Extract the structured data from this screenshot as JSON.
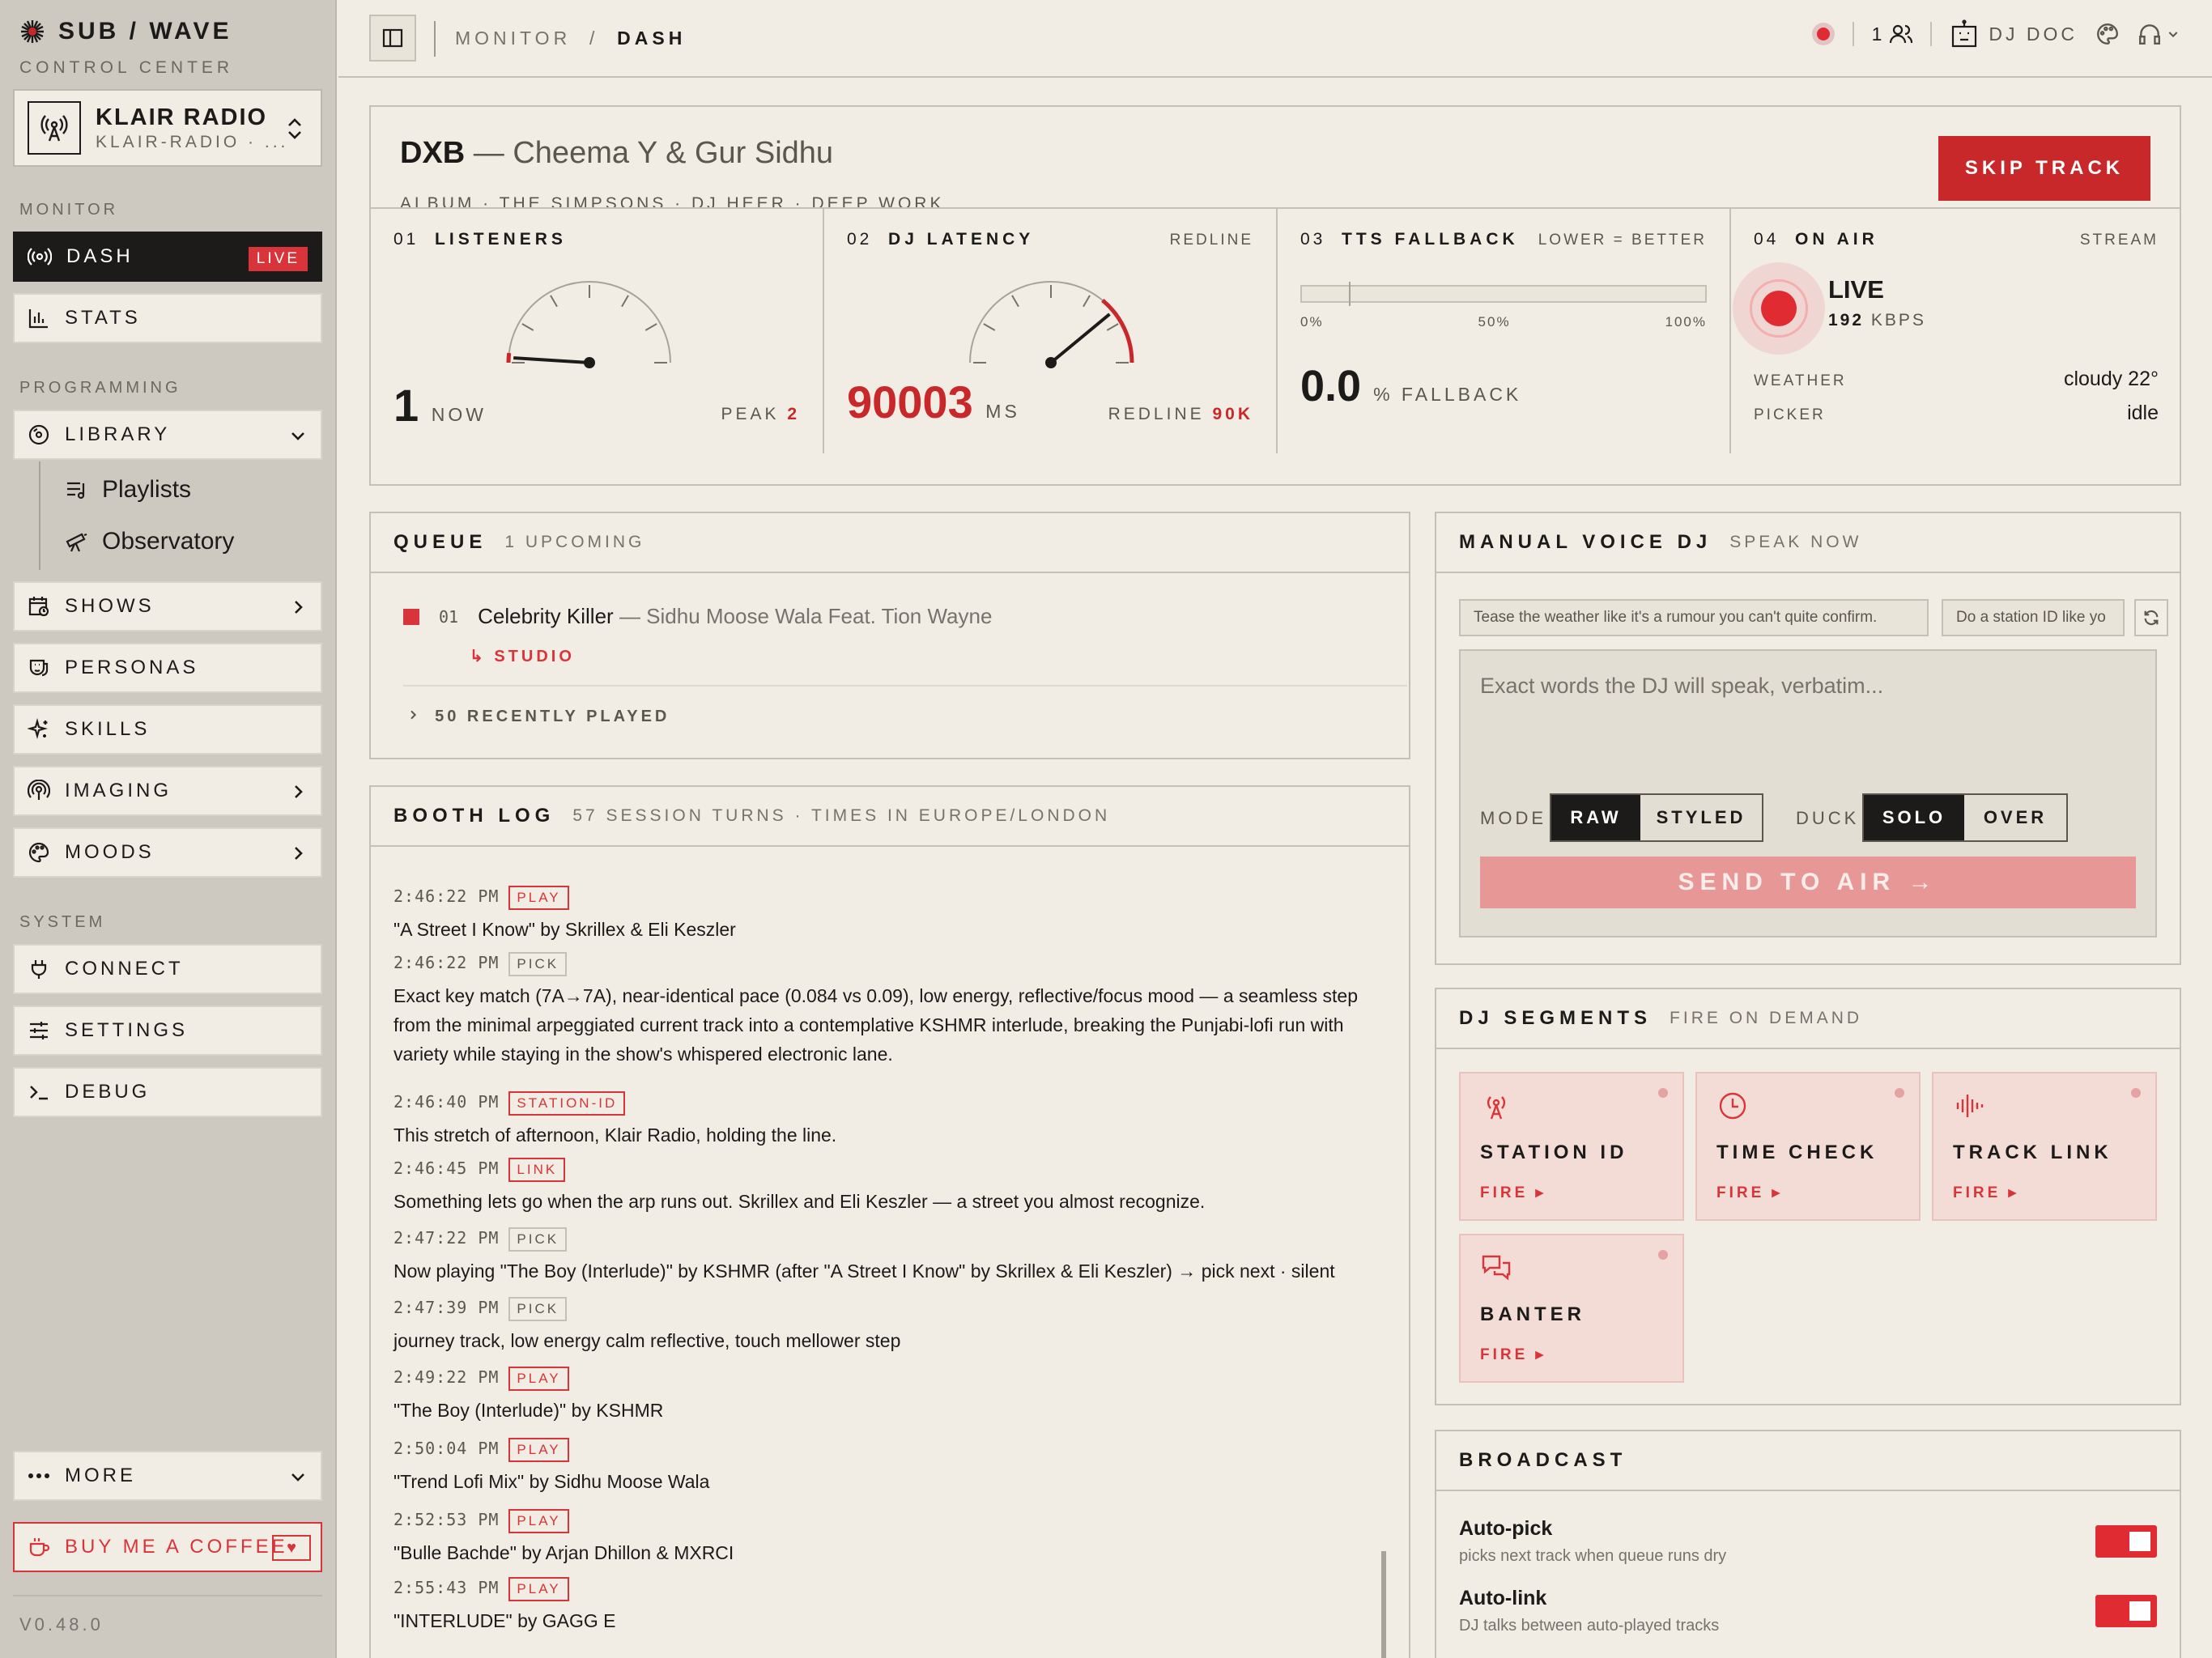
{
  "brand": {
    "title": "SUB / WAVE",
    "subtitle": "CONTROL CENTER"
  },
  "station": {
    "name": "KLAIR RADIO",
    "slug": "KLAIR-RADIO · ..."
  },
  "sidebar": {
    "sections": {
      "monitor": "MONITOR",
      "programming": "PROGRAMMING",
      "system": "SYSTEM"
    },
    "dash": "DASH",
    "live_badge": "LIVE",
    "stats": "STATS",
    "library": "LIBRARY",
    "playlists": "Playlists",
    "observatory": "Observatory",
    "shows": "SHOWS",
    "personas": "PERSONAS",
    "skills": "SKILLS",
    "imaging": "IMAGING",
    "moods": "MOODS",
    "connect": "CONNECT",
    "settings": "SETTINGS",
    "debug": "DEBUG",
    "more": "MORE",
    "coffee": "BUY ME A COFFEE",
    "version": "V0.48.0"
  },
  "topbar": {
    "crumb_root": "MONITOR",
    "crumb_sep": "/",
    "crumb_page": "DASH",
    "listeners": "1",
    "dj": "DJ DOC"
  },
  "now_playing": {
    "title": "DXB",
    "artists": "— Cheema Y & Gur Sidhu",
    "meta": "ALBUM · THE SIMPSONS · DJ HEER · DEEP WORK",
    "skip_label": "SKIP TRACK"
  },
  "stats": {
    "listeners": {
      "num": "01",
      "label": "LISTENERS",
      "value": "1",
      "unit": "NOW",
      "peak_label": "PEAK",
      "peak": "2",
      "gauge_fraction": 0.02
    },
    "latency": {
      "num": "02",
      "label": "DJ LATENCY",
      "right": "REDLINE",
      "value": "90003",
      "unit": "MS",
      "redline_label": "REDLINE",
      "redline": "90K",
      "gauge_fraction": 0.78
    },
    "tts": {
      "num": "03",
      "label": "TTS FALLBACK",
      "right": "LOWER = BETTER",
      "ticks": [
        "0%",
        "50%",
        "100%"
      ],
      "value": "0.0",
      "unit": "% FALLBACK"
    },
    "onair": {
      "num": "04",
      "label": "ON AIR",
      "right": "STREAM",
      "status": "LIVE",
      "bitrate": "192",
      "bitrate_unit": "KBPS",
      "weather_label": "WEATHER",
      "weather": "cloudy 22°",
      "picker_label": "PICKER",
      "picker": "idle"
    }
  },
  "queue": {
    "title": "QUEUE",
    "subtitle": "1 UPCOMING",
    "item": {
      "index": "01",
      "track": "Celebrity Killer",
      "artist": "— Sidhu Moose Wala Feat. Tion Wayne",
      "source": "↳ STUDIO"
    },
    "recent": "50 RECENTLY PLAYED"
  },
  "booth_log": {
    "title": "BOOTH LOG",
    "subtitle": "57 SESSION TURNS · TIMES IN EUROPE/LONDON",
    "entries": [
      {
        "time": "2:46:22 PM",
        "tag": "PLAY",
        "msg": "\"A Street I Know\" by Skrillex & Eli Keszler"
      },
      {
        "time": "2:46:22 PM",
        "tag": "PICK",
        "msg": "Exact key match (7A→7A), near-identical pace (0.084 vs 0.09), low energy, reflective/focus mood — a seamless step from the minimal arpeggiated current track into a contemplative KSHMR interlude, breaking the Punjabi-lofi run with variety while staying in the show's whispered electronic lane."
      },
      {
        "time": "2:46:40 PM",
        "tag": "STATION-ID",
        "msg": "This stretch of afternoon, Klair Radio, holding the line."
      },
      {
        "time": "2:46:45 PM",
        "tag": "LINK",
        "msg": "Something lets go when the arp runs out. Skrillex and Eli Keszler — a street you almost recognize."
      },
      {
        "time": "2:47:22 PM",
        "tag": "PICK",
        "msg": "Now playing \"The Boy (Interlude)\" by KSHMR (after \"A Street I Know\" by Skrillex & Eli Keszler) → pick next · silent"
      },
      {
        "time": "2:47:39 PM",
        "tag": "PICK",
        "msg": "journey track, low energy calm reflective, touch mellower step"
      },
      {
        "time": "2:49:22 PM",
        "tag": "PLAY",
        "msg": "\"The Boy (Interlude)\" by KSHMR"
      },
      {
        "time": "2:50:04 PM",
        "tag": "PLAY",
        "msg": "\"Trend Lofi Mix\" by Sidhu Moose Wala"
      },
      {
        "time": "2:52:53 PM",
        "tag": "PLAY",
        "msg": "\"Bulle Bachde\" by Arjan Dhillon & MXRCI"
      },
      {
        "time": "2:55:43 PM",
        "tag": "PLAY",
        "msg": "\"INTERLUDE\" by GAGG E"
      }
    ]
  },
  "voice_dj": {
    "title": "MANUAL VOICE DJ",
    "subtitle": "SPEAK NOW",
    "chips": [
      "Tease the weather like it's a rumour you can't quite confirm.",
      "Do a station ID like yo"
    ],
    "placeholder": "Exact words the DJ will speak, verbatim...",
    "mode_label": "MODE",
    "mode_options": [
      "RAW",
      "STYLED"
    ],
    "duck_label": "DUCK",
    "duck_options": [
      "SOLO",
      "OVER"
    ],
    "send_label": "SEND TO AIR →"
  },
  "segments": {
    "title": "DJ SEGMENTS",
    "subtitle": "FIRE ON DEMAND",
    "fire": "FIRE ▸",
    "cards": [
      "STATION ID",
      "TIME CHECK",
      "TRACK LINK",
      "BANTER"
    ]
  },
  "broadcast": {
    "title": "BROADCAST",
    "rows": [
      {
        "name": "Auto-pick",
        "desc": "picks next track when queue runs dry",
        "on": true
      },
      {
        "name": "Auto-link",
        "desc": "DJ talks between auto-played tracks",
        "on": true
      }
    ]
  },
  "colors": {
    "accent": "#c8282a",
    "live": "#e02b33",
    "bg": "#f1ede4",
    "sidebar": "#cdc9c0"
  }
}
